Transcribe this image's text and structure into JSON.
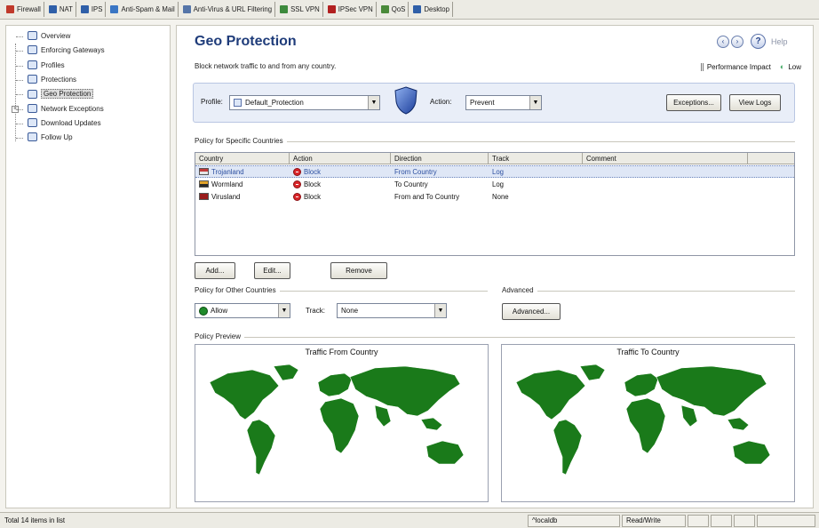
{
  "toolbar": {
    "tabs": [
      {
        "label": "Firewall",
        "icon": "firewall-icon",
        "color": "#c0392b"
      },
      {
        "label": "NAT",
        "icon": "nat-icon",
        "color": "#2f5fa8"
      },
      {
        "label": "IPS",
        "icon": "ips-icon",
        "color": "#2f5fa8"
      },
      {
        "label": "Anti-Spam & Mail",
        "icon": "mail-icon",
        "color": "#3a76c4"
      },
      {
        "label": "Anti-Virus & URL Filtering",
        "icon": "antivirus-icon",
        "color": "#5575a8"
      },
      {
        "label": "SSL VPN",
        "icon": "ssl-vpn-icon",
        "color": "#3d8a3d"
      },
      {
        "label": "IPSec VPN",
        "icon": "ipsec-vpn-icon",
        "color": "#b22020"
      },
      {
        "label": "QoS",
        "icon": "qos-icon",
        "color": "#4a8a3a"
      },
      {
        "label": "Desktop",
        "icon": "desktop-icon",
        "color": "#2f5fa8"
      }
    ]
  },
  "tree": {
    "items": [
      {
        "label": "Overview",
        "icon": "overview-icon"
      },
      {
        "label": "Enforcing Gateways",
        "icon": "gateway-icon"
      },
      {
        "label": "Profiles",
        "icon": "profiles-icon"
      },
      {
        "label": "Protections",
        "icon": "protections-icon"
      },
      {
        "label": "Geo Protection",
        "icon": "geo-protection-icon",
        "selected": true
      },
      {
        "label": "Network Exceptions",
        "icon": "network-exceptions-icon"
      },
      {
        "label": "Download Updates",
        "icon": "download-icon"
      },
      {
        "label": "Follow Up",
        "icon": "follow-up-icon"
      }
    ]
  },
  "main": {
    "title": "Geo Protection",
    "subtitle": "Block network traffic to and from any country.",
    "help_label": "Help",
    "performance": {
      "label": "Performance Impact",
      "value": "Low"
    },
    "profile_label": "Profile:",
    "profile_value": "Default_Protection",
    "action_label": "Action:",
    "action_value": "Prevent",
    "exceptions_button": "Exceptions...",
    "view_logs_button": "View Logs",
    "specific_group": "Policy for Specific Countries",
    "table": {
      "headers": [
        "Country",
        "Action",
        "Direction",
        "Track",
        "Comment"
      ],
      "rows": [
        {
          "country": "Trojanland",
          "action": "Block",
          "direction": "From Country",
          "track": "Log",
          "comment": "",
          "flag_top": "#c23a3a",
          "flag_bottom": "#e5e5e5"
        },
        {
          "country": "Wormland",
          "action": "Block",
          "direction": "To Country",
          "track": "Log",
          "comment": "",
          "flag_top": "#e2a32a",
          "flag_bottom": "#2a2a2a"
        },
        {
          "country": "Virusland",
          "action": "Block",
          "direction": "From and To Country",
          "track": "None",
          "comment": "",
          "flag_top": "#9a1c1c",
          "flag_bottom": "#9a1c1c"
        }
      ]
    },
    "add_button": "Add...",
    "edit_button": "Edit...",
    "remove_button": "Remove",
    "other_group": "Policy for Other Countries",
    "other_action": "Allow",
    "track_label": "Track:",
    "track_value": "None",
    "advanced_group": "Advanced",
    "advanced_button": "Advanced...",
    "preview_group": "Policy Preview",
    "map_from_title": "Traffic From Country",
    "map_to_title": "Traffic To Country",
    "map_color": "#1a7a1a"
  },
  "status": {
    "items_text": "Total 14 items in list",
    "db": "^localdb",
    "mode": "Read/Write"
  }
}
